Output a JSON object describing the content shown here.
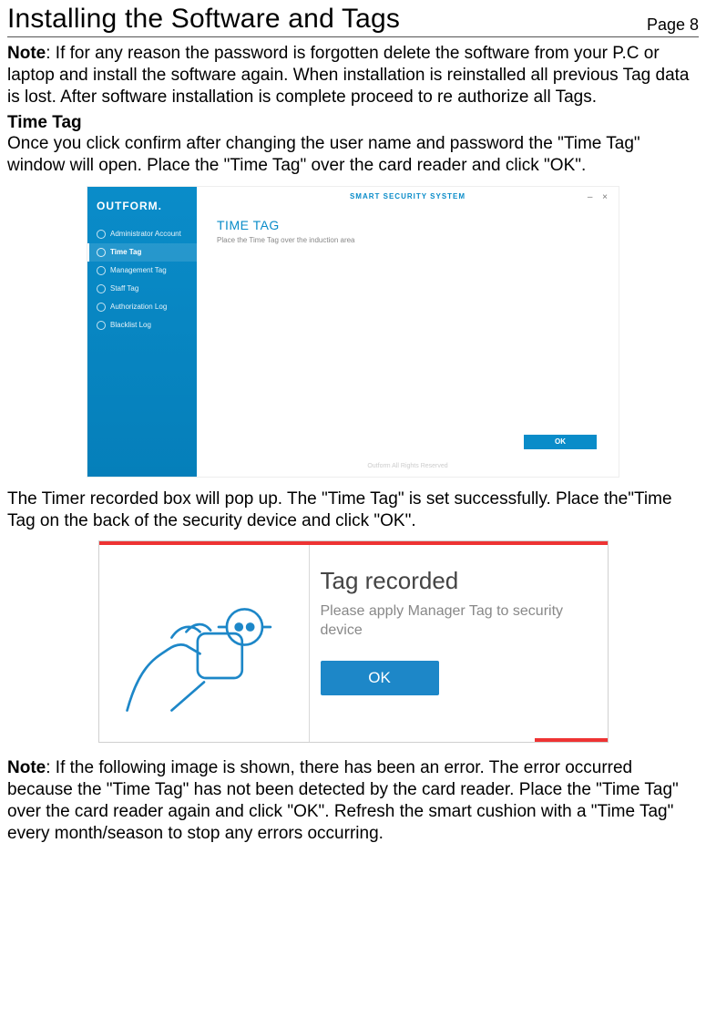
{
  "header": {
    "title": "Installing the Software and Tags",
    "page": "Page 8"
  },
  "para_note1_label": "Note",
  "para_note1_text": ": If for any reason the password is forgotten delete the software from your P.C or laptop and install the software again. When installation is reinstalled all previous Tag data is lost. After  software installation is complete proceed to  re authorize all Tags.",
  "subhead_timetag": "Time Tag",
  "para_timetag_intro": "Once you click confirm after changing the user name and password the \"Time Tag\" window will open.  Place the \"Time Tag\" over the card reader and click \"OK\".",
  "screenshot1": {
    "brand": "OUTFORM.",
    "watermark": "SMART SECURITY SYSTEM",
    "winbuttons": "–  ×",
    "nav": [
      "Administrator Account",
      "Time Tag",
      "Management Tag",
      "Staff Tag",
      "Authorization Log",
      "Blacklist Log"
    ],
    "heading": "TIME TAG",
    "subline": "Place the Time Tag over the induction area",
    "ok": "OK",
    "footer": "Outform All Rights Reserved"
  },
  "para_after_shot1": "The Timer recorded box will pop up. The \"Time Tag\" is set successfully. Place the\"Time Tag on the back of the security device and click \"OK\".",
  "screenshot2": {
    "title": "Tag recorded",
    "body": "Please apply Manager Tag to security device",
    "ok": "OK"
  },
  "para_note2_label": "Note",
  "para_note2_text": ": If the following image is shown, there has been an error. The error occurred because the \"Time Tag\" has not been detected by the card reader. Place the \"Time Tag\" over the card reader again and click \"OK\". Refresh the smart cushion with a \"Time Tag\" every month/season to stop any errors occurring."
}
